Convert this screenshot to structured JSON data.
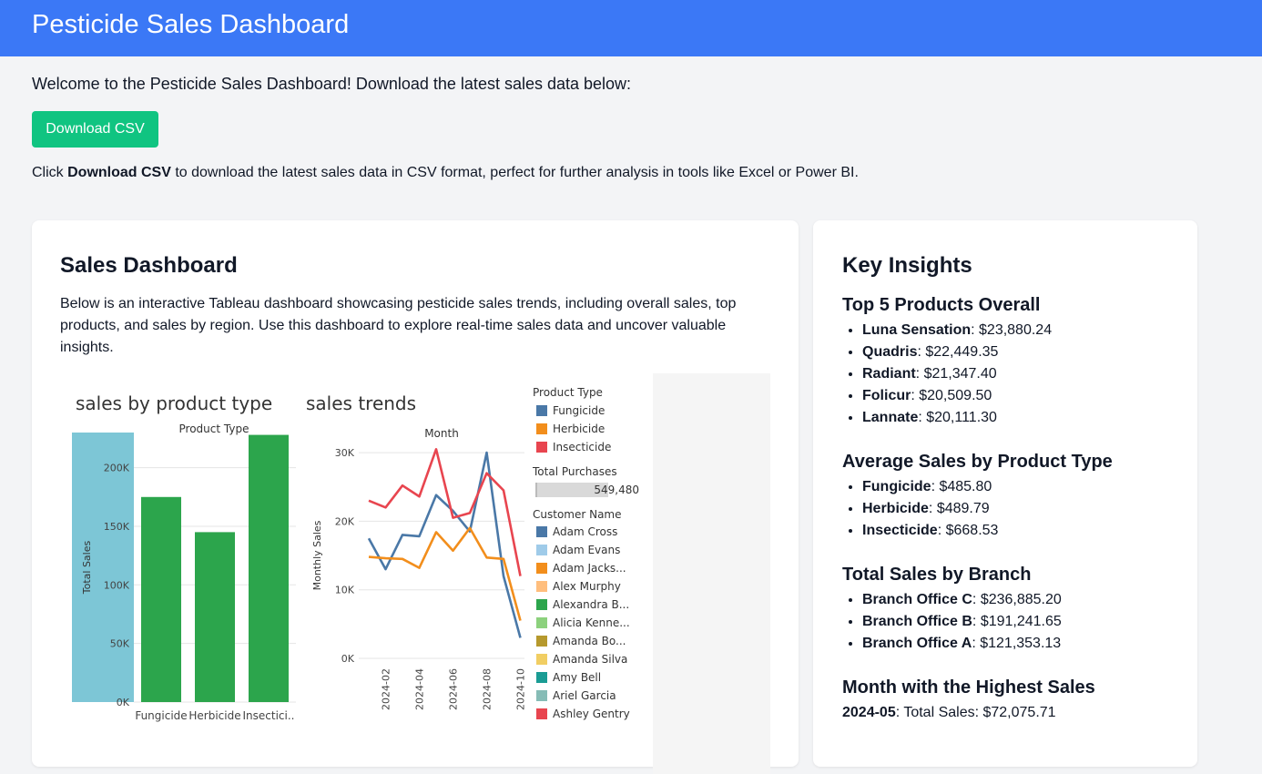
{
  "header": {
    "title": "Pesticide Sales Dashboard"
  },
  "intro": {
    "welcome": "Welcome to the Pesticide Sales Dashboard! Download the latest sales data below:",
    "download_label": "Download CSV",
    "note_prefix": "Click ",
    "note_bold": "Download CSV",
    "note_suffix": " to download the latest sales data in CSV format, perfect for further analysis in tools like Excel or Power BI."
  },
  "dashboard": {
    "title": "Sales Dashboard",
    "description": "Below is an interactive Tableau dashboard showcasing pesticide sales trends, including overall sales, top products, and sales by region. Use this dashboard to explore real-time sales data and uncover valuable insights."
  },
  "chart_data": [
    {
      "type": "bar",
      "title": "sales by product type",
      "column_header": "Product Type",
      "categories": [
        "Fungicide",
        "Herbicide",
        "Insecticide"
      ],
      "category_labels": [
        "Fungicide",
        "Herbicide",
        "Insectici.."
      ],
      "values": [
        175000,
        145000,
        228000
      ],
      "ylabel": "Total Sales",
      "ylim": [
        0,
        230000
      ],
      "yticks": [
        "0K",
        "50K",
        "100K",
        "150K",
        "200K"
      ],
      "colors": {
        "bar": "#2ca54c",
        "highlight": "#7dc6d6"
      }
    },
    {
      "type": "line",
      "title": "sales trends",
      "column_header": "Month",
      "x": [
        "2024-01",
        "2024-02",
        "2024-03",
        "2024-04",
        "2024-05",
        "2024-06",
        "2024-07",
        "2024-08",
        "2024-09",
        "2024-10",
        "2024-11"
      ],
      "xticks": [
        "2024-02",
        "2024-04",
        "2024-06",
        "2024-08",
        "2024-10"
      ],
      "ylabel": "Monthly Sales",
      "ylim": [
        0,
        32000
      ],
      "yticks": [
        "0K",
        "10K",
        "20K",
        "30K"
      ],
      "series": [
        {
          "name": "Fungicide",
          "color": "#4a78a7",
          "values": [
            17500,
            13000,
            18000,
            17800,
            23800,
            21500,
            18500,
            30000,
            12000,
            3000
          ]
        },
        {
          "name": "Herbicide",
          "color": "#f28e1c",
          "values": [
            14800,
            14600,
            14500,
            13200,
            18400,
            15700,
            19000,
            14700,
            14500,
            5500
          ]
        },
        {
          "name": "Insecticide",
          "color": "#e8454f",
          "values": [
            23000,
            22000,
            25200,
            23600,
            30500,
            20500,
            21200,
            27000,
            24500,
            12000
          ]
        }
      ]
    }
  ],
  "legend": {
    "product_type_title": "Product Type",
    "product_types": [
      {
        "name": "Fungicide",
        "color": "#4a78a7"
      },
      {
        "name": "Herbicide",
        "color": "#f28e1c"
      },
      {
        "name": "Insecticide",
        "color": "#e8454f"
      }
    ],
    "total_purchases_title": "Total Purchases",
    "total_purchases_value": "549,480",
    "customer_title": "Customer Name",
    "customers": [
      {
        "name": "Adam Cross",
        "color": "#4a78a7"
      },
      {
        "name": "Adam Evans",
        "color": "#9fcbe9"
      },
      {
        "name": "Adam Jacks...",
        "color": "#f28e1c"
      },
      {
        "name": "Alex Murphy",
        "color": "#ffbe7d"
      },
      {
        "name": "Alexandra B...",
        "color": "#2ca54c"
      },
      {
        "name": "Alicia Kenne...",
        "color": "#8cd17d"
      },
      {
        "name": "Amanda Bo...",
        "color": "#b6992d"
      },
      {
        "name": "Amanda Silva",
        "color": "#f1ce63"
      },
      {
        "name": "Amy Bell",
        "color": "#1a9c94"
      },
      {
        "name": "Ariel Garcia",
        "color": "#86bcb6"
      },
      {
        "name": "Ashley Gentry",
        "color": "#e8454f"
      }
    ]
  },
  "insights": {
    "title": "Key Insights",
    "top_products": {
      "heading": "Top 5 Products Overall",
      "items": [
        {
          "name": "Luna Sensation",
          "value": ": $23,880.24"
        },
        {
          "name": "Quadris",
          "value": ": $22,449.35"
        },
        {
          "name": "Radiant",
          "value": ": $21,347.40"
        },
        {
          "name": "Folicur",
          "value": ": $20,509.50"
        },
        {
          "name": "Lannate",
          "value": ": $20,111.30"
        }
      ]
    },
    "avg_by_type": {
      "heading": "Average Sales by Product Type",
      "items": [
        {
          "name": "Fungicide",
          "value": ": $485.80"
        },
        {
          "name": "Herbicide",
          "value": ": $489.79"
        },
        {
          "name": "Insecticide",
          "value": ": $668.53"
        }
      ]
    },
    "by_branch": {
      "heading": "Total Sales by Branch",
      "items": [
        {
          "name": "Branch Office C",
          "value": ": $236,885.20"
        },
        {
          "name": "Branch Office B",
          "value": ": $191,241.65"
        },
        {
          "name": "Branch Office A",
          "value": ": $121,353.13"
        }
      ]
    },
    "highest_month": {
      "heading": "Month with the Highest Sales",
      "month": "2024-05",
      "value": ": Total Sales: $72,075.71"
    }
  }
}
